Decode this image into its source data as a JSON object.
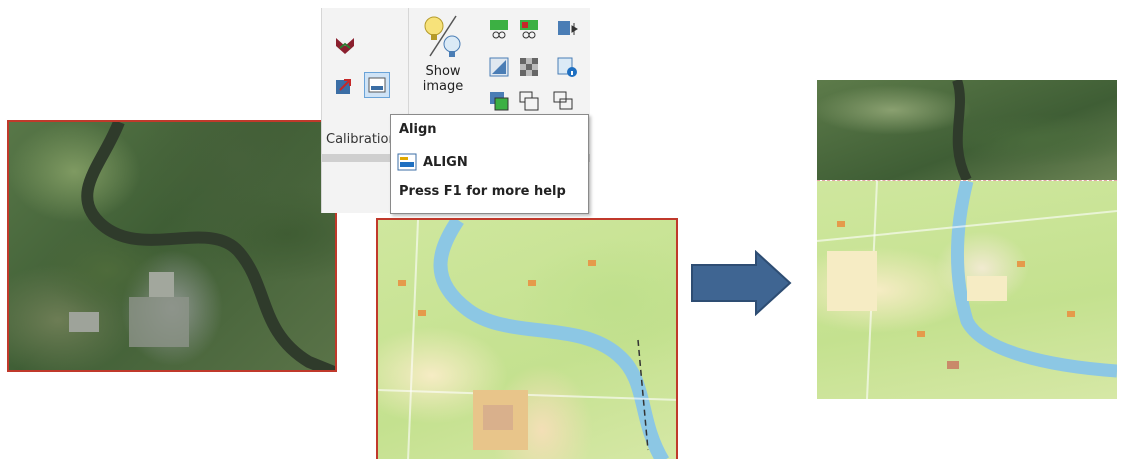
{
  "ribbon": {
    "show_image_label_line1": "Show",
    "show_image_label_line2": "image",
    "group_label": "Calibration"
  },
  "tooltip": {
    "title": "Align",
    "command": "ALIGN",
    "help": "Press F1 for more help"
  },
  "colors": {
    "border_red": "#c0392b",
    "arrow_fill": "#3f6592",
    "tooltip_border": "#8a8a8a",
    "selected_button": "#cfe3f6"
  },
  "icons": [
    "calibrate-icon",
    "align-icon",
    "insert-icon",
    "show-image-icon",
    "clip-icon",
    "transparency-icon",
    "image-info-icon",
    "arrange-icon",
    "right-arrow-icon"
  ]
}
